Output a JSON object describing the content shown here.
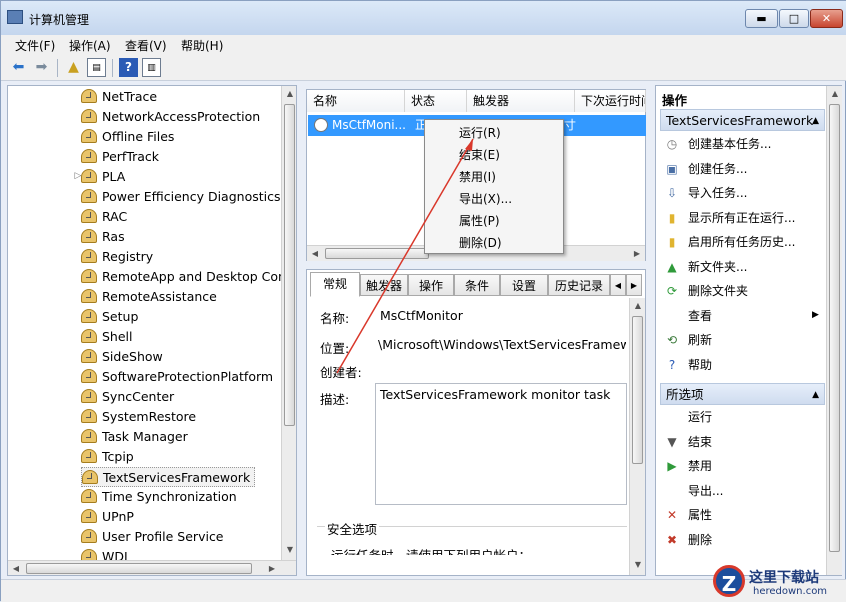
{
  "window": {
    "title": "计算机管理",
    "min": "▬",
    "max": "□",
    "close": "✕"
  },
  "menu": [
    "文件(F)",
    "操作(A)",
    "查看(V)",
    "帮助(H)"
  ],
  "tree": {
    "items": [
      "NetTrace",
      "NetworkAccessProtection",
      "Offline Files",
      "PerfTrack",
      "PLA",
      "Power Efficiency Diagnostics",
      "RAC",
      "Ras",
      "Registry",
      "RemoteApp and Desktop Conn",
      "RemoteAssistance",
      "Setup",
      "Shell",
      "SideShow",
      "SoftwareProtectionPlatform",
      "SyncCenter",
      "SystemRestore",
      "Task Manager",
      "Tcpip",
      "TextServicesFramework",
      "Time Synchronization",
      "UPnP",
      "User Profile Service",
      "WDI"
    ],
    "selected": "TextServicesFramework",
    "expander_item": "PLA"
  },
  "list": {
    "columns": [
      "名称",
      "状态",
      "触发器",
      "下次运行时间"
    ],
    "row": {
      "name": "MsCtfMoni...",
      "status": "正",
      "trigger_tail": "寸"
    }
  },
  "context_menu": [
    "运行(R)",
    "结束(E)",
    "禁用(I)",
    "导出(X)...",
    "属性(P)",
    "删除(D)"
  ],
  "tabs": [
    "常规",
    "触发器",
    "操作",
    "条件",
    "设置",
    "历史记录"
  ],
  "general": {
    "name_label": "名称:",
    "name_value": "MsCtfMonitor",
    "location_label": "位置:",
    "location_value": "\\Microsoft\\Windows\\TextServicesFramewo",
    "author_label": "创建者:",
    "desc_label": "描述:",
    "desc_value": "TextServicesFramework monitor task",
    "security_label": "安全选项",
    "security_text": "运行任务时，请使用下列用户帐户："
  },
  "actions": {
    "header": "操作",
    "section1": "TextServicesFramework",
    "items1": [
      "创建基本任务...",
      "创建任务...",
      "导入任务...",
      "显示所有正在运行...",
      "启用所有任务历史...",
      "新文件夹...",
      "删除文件夹",
      "查看",
      "刷新",
      "帮助"
    ],
    "section2": "所选项",
    "items2": [
      "运行",
      "结束",
      "禁用",
      "导出...",
      "属性",
      "删除"
    ]
  },
  "watermark": {
    "logo": "Z",
    "cn": "这里下载站",
    "en": "heredown.com"
  },
  "colors": {
    "selection": "#3399ff",
    "accent": "#1d4e9c"
  }
}
